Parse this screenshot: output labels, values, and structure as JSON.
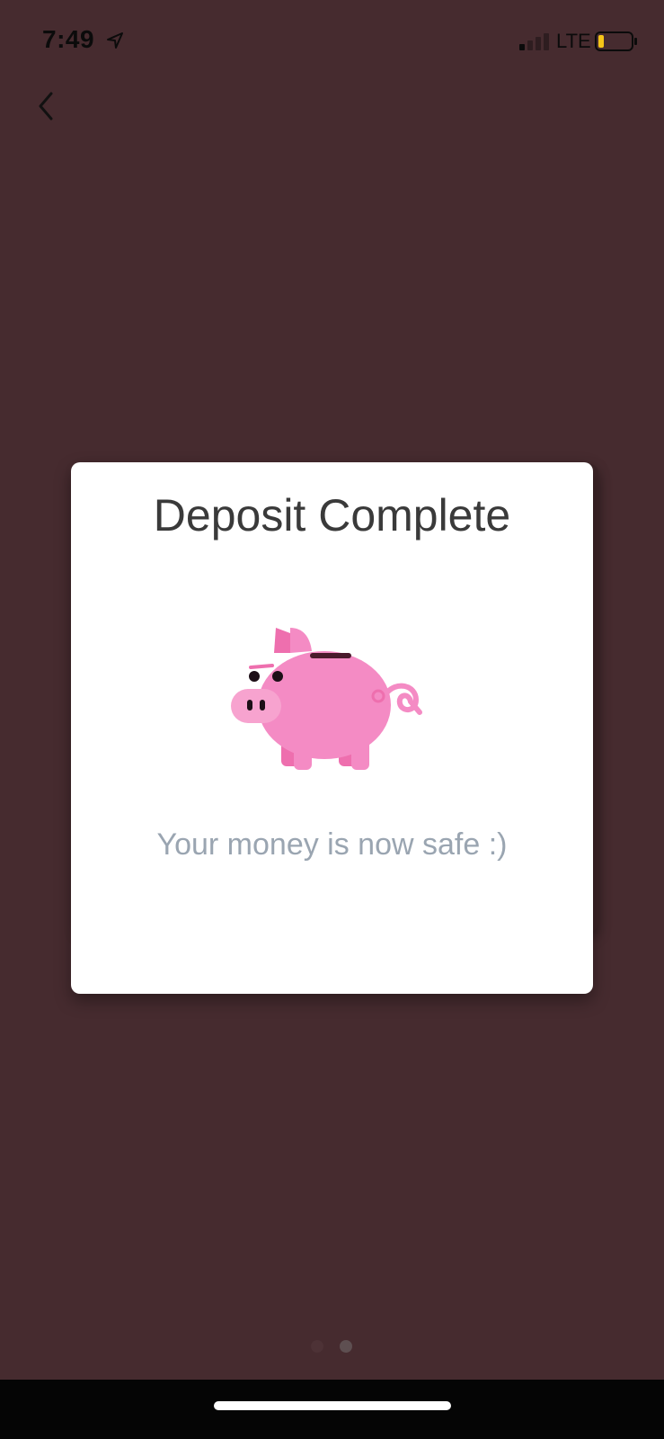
{
  "status_bar": {
    "time": "7:49",
    "network": "LTE",
    "icons": [
      "location-arrow-icon",
      "signal-icon",
      "battery-icon"
    ]
  },
  "navigation": {
    "back_icon": "chevron-left-icon"
  },
  "dialog": {
    "title": "Deposit Complete",
    "illustration": "piggy-bank-icon",
    "message": "Your money is now safe :)"
  },
  "pager": {
    "total_pages": 2,
    "active_page": 2
  },
  "colors": {
    "background": "#462b2f",
    "card": "#ffffff",
    "pig_body": "#f48bc4",
    "pig_dark": "#ee6fae",
    "title_text": "#3a3a3a",
    "message_text": "#9aa5b1",
    "battery_level": "#f5c518"
  }
}
